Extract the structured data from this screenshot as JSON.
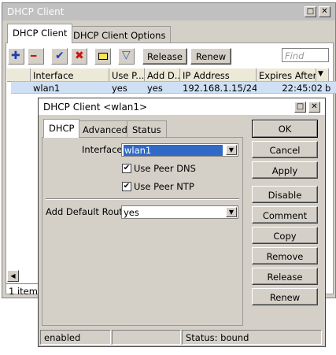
{
  "outer_window": {
    "title": "DHCP Client",
    "controls": {
      "restore": "□",
      "close": "✕"
    },
    "tabs": [
      {
        "label": "DHCP Client"
      },
      {
        "label": "DHCP Client Options"
      }
    ],
    "toolbar": {
      "buttons": [
        {
          "name": "add",
          "glyph": "✚",
          "color": "#1c3cb8"
        },
        {
          "name": "remove",
          "glyph": "━",
          "color": "#cc1111"
        },
        {
          "name": "enable",
          "glyph": "✔",
          "color": "#1c3cb8"
        },
        {
          "name": "disable",
          "glyph": "✖",
          "color": "#cc1111"
        },
        {
          "name": "comment",
          "glyph": "▭",
          "color": "#c8a200"
        },
        {
          "name": "filter",
          "glyph": "▽",
          "color": "#2f5fa8"
        }
      ],
      "release_label": "Release",
      "renew_label": "Renew",
      "find_placeholder": "Find"
    },
    "table": {
      "columns": [
        "Interface",
        "Use P...",
        "Add D...",
        "IP Address",
        "Expires After"
      ],
      "rows": [
        {
          "interface": "wlan1",
          "use_peer_dns": "yes",
          "add_default": "yes",
          "ip": "192.168.1.15/24",
          "expires": "22:45:02",
          "extra": "b"
        }
      ]
    },
    "status_text": "1 item ("
  },
  "dialog": {
    "title": "DHCP Client <wlan1>",
    "controls": {
      "restore": "□",
      "close": "✕"
    },
    "tabs": [
      {
        "label": "DHCP"
      },
      {
        "label": "Advanced"
      },
      {
        "label": "Status"
      }
    ],
    "interface_label": "Interface:",
    "interface_value": "wlan1",
    "use_peer_dns_label": "Use Peer DNS",
    "use_peer_ntp_label": "Use Peer NTP",
    "check_mark": "✔",
    "add_default_route_label": "Add Default Route:",
    "add_default_route_value": "yes",
    "buttons": [
      "OK",
      "Cancel",
      "Apply",
      "Disable",
      "Comment",
      "Copy",
      "Remove",
      "Release",
      "Renew"
    ],
    "status_bar": {
      "state": "enabled",
      "middle": "",
      "status": "Status: bound"
    }
  }
}
